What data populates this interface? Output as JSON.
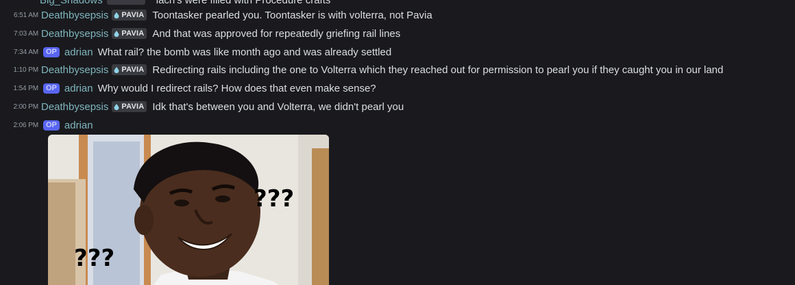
{
  "cutoff": {
    "text": "lach's were filled with Procedure crafts"
  },
  "messages": [
    {
      "time": "6:51 AM",
      "author": "Deathbysepsis",
      "tag": "PAVIA",
      "op": false,
      "text": "Toontasker pearled you. Toontasker is with volterra, not Pavia"
    },
    {
      "time": "7:03 AM",
      "author": "Deathbysepsis",
      "tag": "PAVIA",
      "op": false,
      "text": "And that was approved for repeatedly griefing rail lines"
    },
    {
      "time": "7:34 AM",
      "author": "adrian",
      "tag": "OP",
      "op": true,
      "text": "What rail? the bomb was like month ago and was already settled"
    },
    {
      "time": "1:10 PM",
      "author": "Deathbysepsis",
      "tag": "PAVIA",
      "op": false,
      "text": "Redirecting rails including the one to Volterra which they reached out for permission to pearl you if they caught you in our land"
    },
    {
      "time": "1:54 PM",
      "author": "adrian",
      "tag": "OP",
      "op": true,
      "text": "Why would I redirect rails? How does  that even make sense?"
    },
    {
      "time": "2:00 PM",
      "author": "Deathbysepsis",
      "tag": "PAVIA",
      "op": false,
      "text": "Idk that's between you and Volterra, we didn't pearl you"
    },
    {
      "time": "2:06 PM",
      "author": "adrian",
      "tag": "OP",
      "op": true,
      "text": ""
    }
  ],
  "attachment": {
    "label_left": "???",
    "label_right": "???"
  },
  "colors": {
    "background": "#1a1a1e",
    "author": "#7fb5bd",
    "op_badge": "#5865f2",
    "tag_badge": "#3a3b41"
  }
}
